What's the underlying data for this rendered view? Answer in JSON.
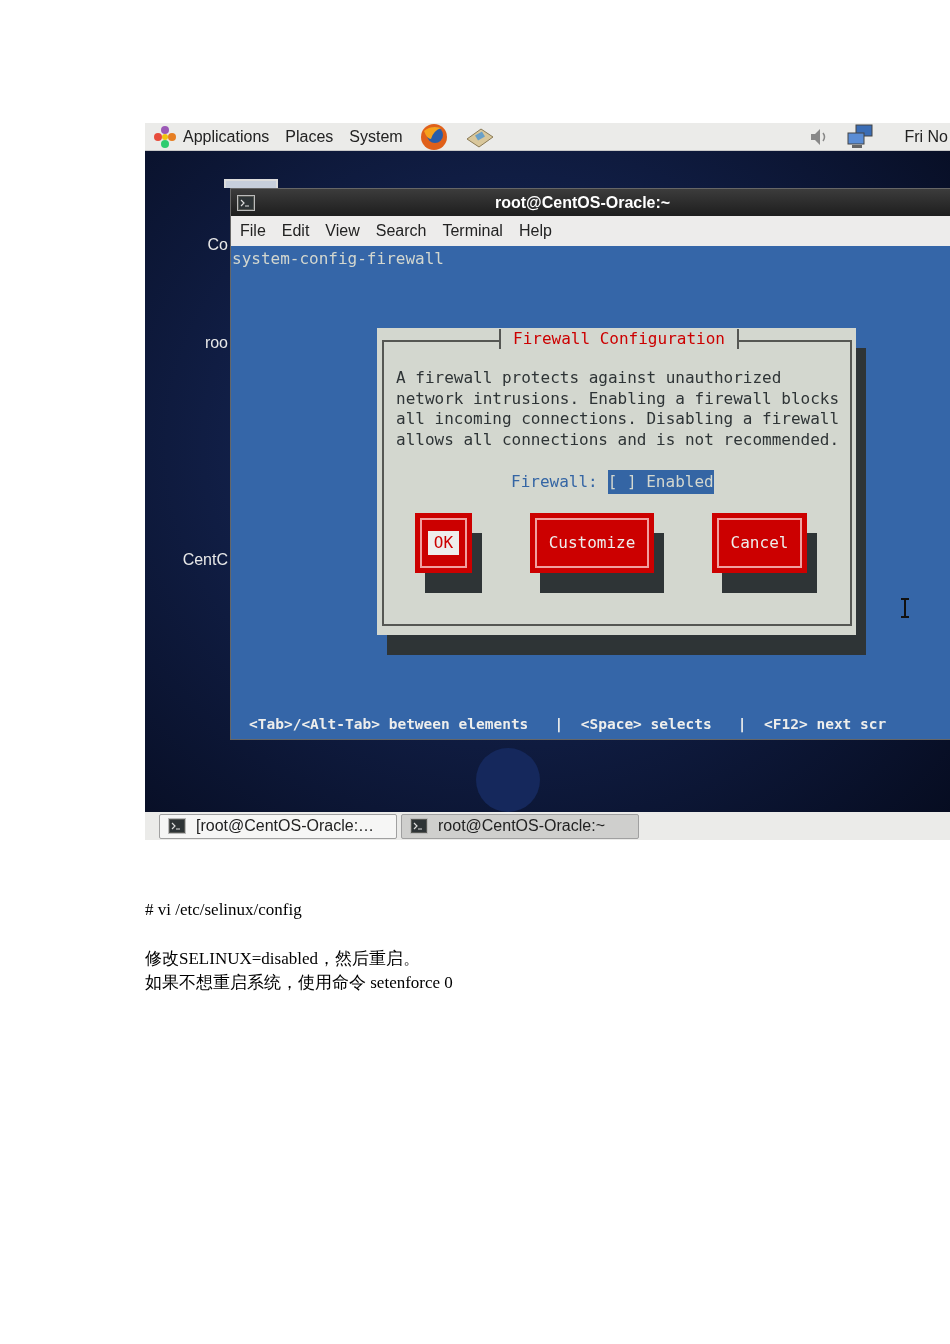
{
  "top_panel": {
    "menus": [
      "Applications",
      "Places",
      "System"
    ],
    "clock": "Fri No"
  },
  "desktop_icons": [
    {
      "label": "Co"
    },
    {
      "label": "roo"
    },
    {
      "label": "CentC"
    }
  ],
  "terminal": {
    "title": "root@CentOS-Oracle:~",
    "menu": [
      "File",
      "Edit",
      "View",
      "Search",
      "Terminal",
      "Help"
    ],
    "command": "system-config-firewall",
    "dialog": {
      "title": "Firewall Configuration",
      "message": "A firewall protects against unauthorized network intrusions. Enabling a firewall blocks all incoming connections. Disabling a firewall allows all connections and is not recommended.",
      "field_label": "Firewall:",
      "checkbox": {
        "text": "[ ] Enabled",
        "selected": true
      },
      "buttons": [
        {
          "label": "OK",
          "selected": true
        },
        {
          "label": "Customize",
          "selected": false
        },
        {
          "label": "Cancel",
          "selected": false
        }
      ]
    },
    "hint": "<Tab>/<Alt-Tab> between elements   |  <Space> selects   |  <F12> next scr"
  },
  "taskbar": [
    {
      "label": "[root@CentOS-Oracle:…",
      "selected": false
    },
    {
      "label": "root@CentOS-Oracle:~",
      "selected": true
    }
  ],
  "document": {
    "command": "# vi /etc/selinux/config",
    "lines": [
      "修改SELINUX=disabled，然后重启。",
      "如果不想重启系统，使用命令 setenforce 0"
    ]
  }
}
